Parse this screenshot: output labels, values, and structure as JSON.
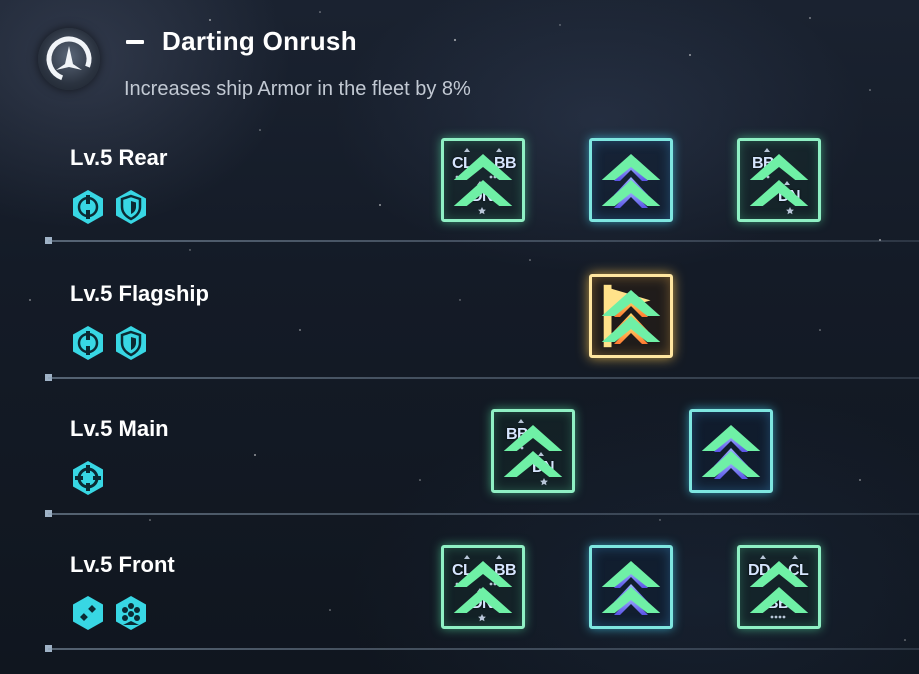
{
  "header": {
    "emblem_icon": "crescent-ship-emblem-icon",
    "title": "Darting Onrush",
    "description": "Increases ship Armor in the fleet by 8%"
  },
  "rows": [
    {
      "label": "Lv.5 Rear",
      "role_icons": [
        "aim-target-icon",
        "shield-icon"
      ],
      "tiles": [
        {
          "kind": "class-group",
          "labels": [
            "CL",
            "BB",
            "DN"
          ]
        },
        {
          "kind": "blue-chevron"
        },
        {
          "kind": "class-group",
          "labels": [
            "BB",
            "DN"
          ]
        }
      ]
    },
    {
      "label": "Lv.5 Flagship",
      "role_icons": [
        "aim-target-icon",
        "shield-icon"
      ],
      "tiles": [
        {
          "kind": "flagship-chevron"
        }
      ]
    },
    {
      "label": "Lv.5 Main",
      "role_icons": [
        "crosshair-icon"
      ],
      "tiles": [
        {
          "kind": "class-group",
          "labels": [
            "BB",
            "DN"
          ]
        },
        {
          "kind": "blue-chevron"
        }
      ]
    },
    {
      "label": "Lv.5 Front",
      "role_icons": [
        "cross-plus-icon",
        "hex-cluster-icon"
      ],
      "tiles": [
        {
          "kind": "class-group",
          "labels": [
            "CL",
            "BB",
            "DN"
          ]
        },
        {
          "kind": "blue-chevron"
        },
        {
          "kind": "class-group",
          "labels": [
            "DD",
            "CL",
            "BB"
          ]
        }
      ]
    }
  ],
  "colors": {
    "tile_green": "#8ff0c4",
    "tile_blue": "#7ee6e0",
    "tile_gold": "#ffe6a0",
    "role_icon": "#38d7e4"
  }
}
